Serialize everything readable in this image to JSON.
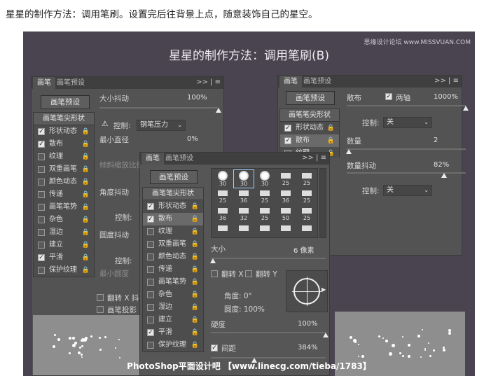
{
  "caption": "星星的制作方法：调用笔刷。设置完后往背景上点，随意装饰自己的星空。",
  "title": "星星的制作方法：调用笔刷(B)",
  "watermark": "思缘设计论坛 www.MISSVUAN.COM",
  "credit": "PhotoShop平面设计吧 【www.linecg.com/tieba/1783】",
  "tabs": {
    "brush": "画笔",
    "preset": "画笔预设"
  },
  "panel_icons": ">> | ≡",
  "preset_button": "画笔预设",
  "tip_shape": "画笔笔尖形状",
  "lock": "🔒",
  "items": [
    "形状动态",
    "散布",
    "纹理",
    "双重画笔",
    "颜色动态",
    "传递",
    "画笔笔势",
    "杂色",
    "湿边",
    "建立",
    "平滑",
    "保护纹理"
  ],
  "left": {
    "checked": [
      true,
      true,
      false,
      false,
      false,
      false,
      false,
      false,
      false,
      false,
      true,
      false
    ],
    "size_jitter": "大小抖动",
    "size_jitter_val": "100%",
    "size_jitter_level": 1.0,
    "control": "控制:",
    "control_val": "钢笔压力",
    "min_diameter": "最小直径",
    "min_diameter_val": "0%",
    "tilt_scale": "倾斜缩放比例",
    "angle_jitter": "角度抖动",
    "roundness_jitter": "圆度抖动",
    "min_roundness": "最小圆度",
    "flip_x": "翻转 X 抖动",
    "brush_proj": "画笔投影"
  },
  "right": {
    "checked": [
      true,
      true,
      false
    ],
    "scatter": "散布",
    "both_axes": "两轴",
    "scatter_val": "1000%",
    "scatter_level": 1.0,
    "control": "控制:",
    "control_val": "关",
    "count": "数量",
    "count_val": "2",
    "count_level": 0.02,
    "count_jitter": "数量抖动",
    "count_jitter_val": "82%",
    "count_jitter_level": 0.82
  },
  "mid": {
    "checked": [
      true,
      true,
      false,
      false,
      false,
      false,
      false,
      false,
      false,
      false,
      true,
      false
    ],
    "tips": [
      "30",
      "30",
      "30",
      "25",
      "25",
      "25",
      "36",
      "25",
      "36",
      "25",
      "36",
      "32",
      "25",
      "50",
      "25",
      "",
      "",
      "",
      "",
      ""
    ],
    "size": "大小",
    "size_val": "6 像素",
    "size_level": 0.02,
    "flipx": "翻转 X",
    "flipy": "翻转 Y",
    "angle": "角度: 0°",
    "roundness": "圆度: 100%",
    "hardness": "硬度",
    "hardness_val": "100%",
    "hardness_level": 1.0,
    "spacing": "间距",
    "spacing_val": "384%",
    "spacing_level": 0.38
  }
}
